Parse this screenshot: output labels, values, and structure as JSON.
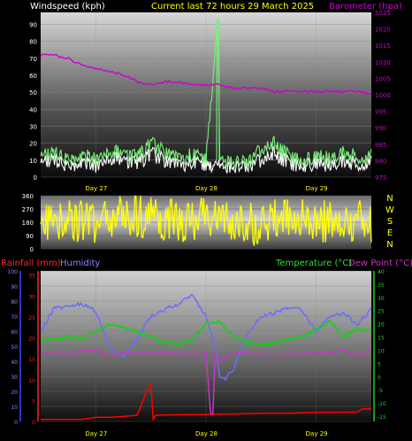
{
  "header": {
    "windspeed_label": "Windspeed (kph)",
    "title": "Current last 72 hours 29 March 2025",
    "barometer_label": "Barometer (hpa)"
  },
  "colors": {
    "windspeed": "#ffffff",
    "gust": "#7cf07c",
    "barometer": "#cc00cc",
    "direction": "#ffff00",
    "rainfall": "#ff0000",
    "humidity": "#6b6bff",
    "temperature": "#00dd00",
    "dewpoint": "#cc33cc",
    "rain_axis": "#ff2222",
    "humidity_axis": "#8888ff",
    "temp_axis": "#33cc33"
  },
  "labels": {
    "rainfall": "Rainfall (mm)",
    "humidity": "Humidity",
    "temperature": "Temperature (°C)",
    "dewpoint": "Dew Point (°C)"
  },
  "chart_data": [
    {
      "type": "line",
      "title": "Current last 72 hours 29 March 2025",
      "x_categories": [
        "Day 27",
        "Day 28",
        "Day 29"
      ],
      "y_left": {
        "label": "Windspeed (kph)",
        "ticks": [
          0,
          10,
          20,
          30,
          40,
          50,
          60,
          70,
          80,
          90
        ],
        "lim": [
          0,
          97
        ]
      },
      "y_right": {
        "label": "Barometer (hpa)",
        "ticks": [
          975,
          980,
          985,
          990,
          995,
          1000,
          1005,
          1010,
          1015,
          1020,
          1025
        ],
        "lim": [
          975,
          1025
        ]
      },
      "series": [
        {
          "name": "Windspeed",
          "axis": "left",
          "x": [
            0,
            3,
            6,
            9,
            12,
            15,
            18,
            21,
            24,
            27,
            30,
            33,
            36,
            39,
            42,
            45,
            48,
            51,
            54,
            57,
            60,
            63,
            66,
            69,
            72
          ],
          "values": [
            8,
            10,
            6,
            9,
            7,
            12,
            9,
            8,
            14,
            10,
            7,
            9,
            6,
            8,
            5,
            6,
            10,
            14,
            8,
            6,
            9,
            7,
            10,
            8,
            9
          ]
        },
        {
          "name": "Gust",
          "axis": "left",
          "x": [
            0,
            3,
            6,
            9,
            12,
            15,
            18,
            21,
            24,
            27,
            30,
            33,
            36,
            38.6,
            39,
            42,
            45,
            48,
            51,
            54,
            57,
            60,
            63,
            66,
            69,
            72
          ],
          "values": [
            12,
            14,
            10,
            13,
            11,
            16,
            13,
            12,
            20,
            15,
            11,
            13,
            10,
            93,
            12,
            8,
            9,
            16,
            20,
            12,
            9,
            13,
            11,
            15,
            12,
            13
          ]
        },
        {
          "name": "Barometer",
          "axis": "right",
          "x": [
            0,
            3,
            6,
            9,
            12,
            15,
            18,
            21,
            24,
            27,
            30,
            33,
            36,
            39,
            42,
            45,
            48,
            51,
            54,
            57,
            60,
            63,
            66,
            69,
            72
          ],
          "values": [
            1012,
            1012,
            1011,
            1009,
            1008,
            1007,
            1006,
            1004,
            1003,
            1004,
            1004,
            1003,
            1003,
            1003,
            1002,
            1002,
            1002,
            1001,
            1001,
            1001,
            1001,
            1001,
            1001,
            1001,
            1000
          ]
        }
      ]
    },
    {
      "type": "line",
      "series_name": "Wind direction",
      "y_left": {
        "ticks": [
          0,
          90,
          180,
          270,
          360
        ],
        "lim": [
          0,
          360
        ]
      },
      "y_right_labels": [
        "N",
        "W",
        "S",
        "E",
        "N"
      ],
      "x": [
        0,
        6,
        12,
        18,
        24,
        30,
        36,
        42,
        48,
        54,
        60,
        66,
        72
      ],
      "values": [
        180,
        200,
        150,
        240,
        200,
        190,
        220,
        160,
        170,
        210,
        180,
        200,
        190
      ]
    },
    {
      "type": "line",
      "x_categories": [
        "Day 27",
        "Day 28",
        "Day 29"
      ],
      "y_rain": {
        "label": "Rainfall (mm)",
        "ticks": [
          0,
          5,
          10,
          15,
          20,
          25,
          30,
          35
        ],
        "lim": [
          0,
          36
        ]
      },
      "y_humidity": {
        "label": "Humidity",
        "ticks": [
          0,
          10,
          20,
          30,
          40,
          50,
          60,
          70,
          80,
          90,
          100
        ],
        "lim": [
          0,
          100
        ]
      },
      "y_temp": {
        "label": "Temperature (°C)",
        "ticks": [
          -15,
          -10,
          -5,
          0,
          5,
          10,
          15,
          20,
          25,
          30,
          35,
          40
        ],
        "lim": [
          -17,
          40
        ]
      },
      "series": [
        {
          "name": "Rainfall",
          "axis": "rain",
          "x": [
            0,
            3,
            6,
            9,
            12,
            15,
            18,
            21,
            23,
            24,
            24.5,
            25,
            30,
            36,
            42,
            48,
            54,
            60,
            66,
            69,
            70,
            72
          ],
          "values": [
            0.5,
            0.5,
            0.5,
            0.5,
            1,
            1,
            1.2,
            1.5,
            7,
            9,
            0.5,
            1.5,
            1.6,
            1.7,
            1.8,
            2,
            2,
            2.2,
            2.2,
            2.3,
            3,
            3
          ]
        },
        {
          "name": "Humidity",
          "axis": "humidity",
          "x": [
            0,
            3,
            6,
            9,
            12,
            15,
            18,
            21,
            24,
            27,
            30,
            33,
            36,
            38,
            39,
            40,
            42,
            45,
            48,
            51,
            54,
            57,
            60,
            63,
            66,
            69,
            72
          ],
          "values": [
            60,
            75,
            77,
            78,
            73,
            50,
            43,
            55,
            70,
            74,
            78,
            84,
            70,
            50,
            30,
            28,
            35,
            58,
            70,
            72,
            76,
            74,
            60,
            70,
            72,
            64,
            75
          ]
        },
        {
          "name": "Temperature",
          "axis": "temp",
          "x": [
            0,
            3,
            6,
            9,
            12,
            15,
            18,
            21,
            24,
            27,
            30,
            33,
            36,
            39,
            42,
            45,
            48,
            51,
            54,
            57,
            60,
            63,
            66,
            69,
            72
          ],
          "values": [
            14,
            14,
            15,
            14,
            17,
            20,
            19,
            17,
            15,
            13,
            12,
            14,
            20,
            21,
            15,
            13,
            12,
            13,
            14,
            15,
            18,
            21,
            15,
            18,
            17
          ]
        },
        {
          "name": "Dew Point",
          "axis": "temp",
          "x": [
            0,
            3,
            6,
            9,
            12,
            15,
            18,
            21,
            24,
            27,
            30,
            33,
            36,
            37,
            37.5,
            38,
            39,
            40,
            42,
            45,
            48,
            51,
            54,
            57,
            60,
            63,
            66,
            69,
            72
          ],
          "values": [
            9,
            9,
            8,
            10,
            10,
            8,
            9,
            9,
            9,
            9,
            9,
            8,
            9,
            -14,
            -14,
            9,
            6,
            7,
            9,
            9,
            8,
            8,
            8,
            9,
            9,
            9,
            10,
            8,
            10
          ]
        }
      ]
    }
  ]
}
